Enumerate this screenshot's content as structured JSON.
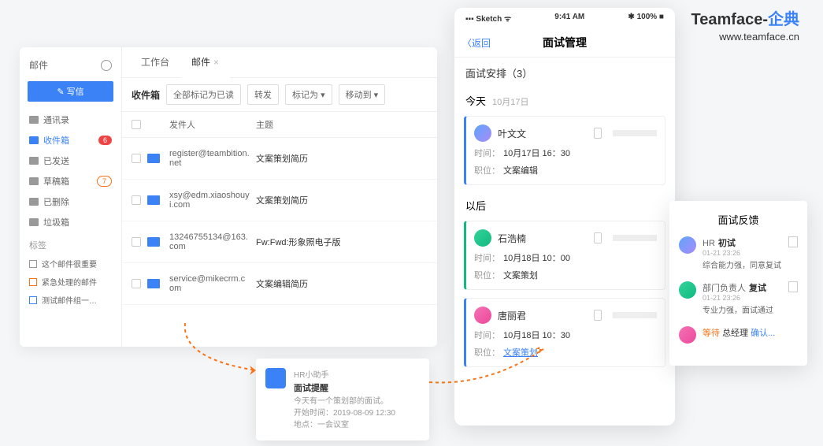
{
  "brand": {
    "name1": "Teamface-",
    "name2": "企典",
    "url": "www.teamface.cn"
  },
  "sidebar": {
    "title": "邮件",
    "compose": "✎ 写信",
    "items": [
      {
        "label": "通讯录"
      },
      {
        "label": "收件箱",
        "badge": "6",
        "cls": "red",
        "active": true
      },
      {
        "label": "已发送"
      },
      {
        "label": "草稿箱",
        "badge": "7",
        "cls": "orange"
      },
      {
        "label": "已删除"
      },
      {
        "label": "垃圾箱"
      }
    ],
    "tagTitle": "标签",
    "tags": [
      {
        "label": "这个邮件很重要",
        "c": ""
      },
      {
        "label": "紧急处理的邮件",
        "c": "o"
      },
      {
        "label": "测试邮件组一…",
        "c": "b"
      }
    ]
  },
  "tabs": [
    {
      "label": "工作台"
    },
    {
      "label": "邮件",
      "active": true,
      "close": "×"
    }
  ],
  "toolbar": {
    "box": "收件箱",
    "mark": "全部标记为已读",
    "fwd": "转发",
    "tag": "标记为 ▾",
    "move": "移动到 ▾"
  },
  "columns": {
    "from": "发件人",
    "subj": "主题"
  },
  "mails": [
    {
      "from": "register@teambition.net",
      "subj": "文案策划简历"
    },
    {
      "from": "xsy@edm.xiaoshouyi.com",
      "subj": "文案策划简历"
    },
    {
      "from": "13246755134@163.com",
      "subj": "Fw:Fwd:形象照电子版"
    },
    {
      "from": "service@mikecrm.com",
      "subj": "文案编辑简历"
    }
  ],
  "notif": {
    "src": "HR小助手",
    "title": "面试提醒",
    "l1": "今天有一个策划部的面试。",
    "l2": "开始时间：2019-08-09 12:30",
    "l3": "地点：一会议室"
  },
  "phone": {
    "status": {
      "l": "▪▪▪ Sketch ᯤ",
      "c": "9:41 AM",
      "r": "✱ 100% ■"
    },
    "back": "〈返回",
    "title": "面试管理",
    "subhead": "面试安排（3）",
    "sections": [
      {
        "title": "今天",
        "date": "10月17日",
        "cards": [
          {
            "name": "叶文文",
            "time": "10月17日 16：30",
            "pos": "文案编辑",
            "ava": ""
          }
        ]
      },
      {
        "title": "以后",
        "cards": [
          {
            "name": "石浩楠",
            "time": "10月18日 10：00",
            "pos": "文案策划",
            "ava": "g",
            "cls": "g"
          },
          {
            "name": "唐丽君",
            "time": "10月18日 10：30",
            "pos": "文案策划",
            "ava": "p",
            "posBlue": true
          }
        ]
      }
    ],
    "labels": {
      "time": "时间：",
      "pos": "职位："
    }
  },
  "feedback": {
    "title": "面试反馈",
    "rows": [
      {
        "role": "HR",
        "stage": "初试",
        "time": "01-21 23:26",
        "txt": "综合能力强，同意复试",
        "ava": ""
      },
      {
        "role": "部门负责人",
        "stage": "复试",
        "time": "01-21 23:26",
        "txt": "专业力强，面试通过",
        "ava": "g"
      }
    ],
    "wait": {
      "w": "等待 ",
      "r": "总经理 ",
      "c": "确认..."
    }
  }
}
